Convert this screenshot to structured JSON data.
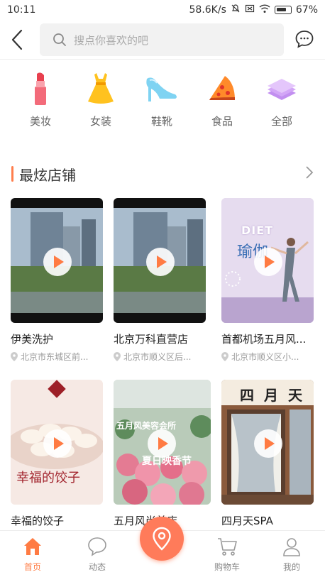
{
  "status": {
    "time": "10:11",
    "net": "58.6K/s",
    "battery": "67%"
  },
  "search": {
    "placeholder": "搜点你喜欢的吧"
  },
  "categories": [
    {
      "label": "美妆",
      "icon": "lipstick-icon"
    },
    {
      "label": "女装",
      "icon": "dress-icon"
    },
    {
      "label": "鞋靴",
      "icon": "high-heel-icon"
    },
    {
      "label": "食品",
      "icon": "pizza-icon"
    },
    {
      "label": "全部",
      "icon": "layers-icon"
    }
  ],
  "section": {
    "title": "最炫店铺"
  },
  "stores": [
    {
      "name": "伊美洗护",
      "address": "北京市东城区前..."
    },
    {
      "name": "北京万科直营店",
      "address": "北京市顺义区后..."
    },
    {
      "name": "首都机场五月风...",
      "address": "北京市顺义区小..."
    },
    {
      "name": "幸福的饺子",
      "address": ""
    },
    {
      "name": "五月风尚美店",
      "address": ""
    },
    {
      "name": "四月天SPA",
      "address": ""
    }
  ],
  "thumb_text": {
    "yoga_diet": "DIET",
    "yoga_title": "瑜伽",
    "dumpling_title": "幸福的饺子",
    "flower_title": "五月风美容会所",
    "flower_sub": "夏日映香节",
    "spa_sign": "四月天"
  },
  "tabs": [
    {
      "label": "首页",
      "icon": "home-icon",
      "active": true
    },
    {
      "label": "动态",
      "icon": "chat-bubble-icon"
    },
    {
      "label": "购物车",
      "icon": "cart-icon"
    },
    {
      "label": "我的",
      "icon": "user-icon"
    }
  ],
  "colors": {
    "accent": "#ff7b43",
    "text": "#333333",
    "muted": "#999999"
  }
}
